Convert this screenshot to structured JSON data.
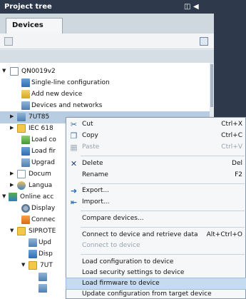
{
  "panel": {
    "title": "Project tree",
    "tab": "Devices"
  },
  "tree": {
    "rows": [
      {
        "label": "QN0019v2"
      },
      {
        "label": "Single-line configuration"
      },
      {
        "label": "Add new device"
      },
      {
        "label": "Devices and networks"
      },
      {
        "label": "7UT85"
      },
      {
        "label": "IEC 618"
      },
      {
        "label": "Load co"
      },
      {
        "label": "Load fir"
      },
      {
        "label": "Upgrad"
      },
      {
        "label": "Docum"
      },
      {
        "label": "Langua"
      },
      {
        "label": "Online acc"
      },
      {
        "label": "Display"
      },
      {
        "label": "Connec"
      },
      {
        "label": "SIPROTE"
      },
      {
        "label": "Upd"
      },
      {
        "label": "Disp"
      },
      {
        "label": "7UT"
      }
    ]
  },
  "context_menu": {
    "items": [
      {
        "label": "Cut",
        "shortcut": "Ctrl+X",
        "icon": "scissors-icon"
      },
      {
        "label": "Copy",
        "shortcut": "Ctrl+C",
        "icon": "copy-icon"
      },
      {
        "label": "Paste",
        "shortcut": "Ctrl+V",
        "icon": "paste-icon"
      },
      {
        "label": "Delete",
        "shortcut": "Del",
        "icon": "delete-icon"
      },
      {
        "label": "Rename",
        "shortcut": "F2"
      },
      {
        "label": "Export...",
        "icon": "export-icon"
      },
      {
        "label": "Import...",
        "icon": "import-icon"
      },
      {
        "label": "Compare devices..."
      },
      {
        "label": "Connect to device and retrieve data",
        "shortcut": "Alt+Ctrl+O"
      },
      {
        "label": "Connect to device"
      },
      {
        "label": "Load configuration to device"
      },
      {
        "label": "Load security settings to device"
      },
      {
        "label": "Load firmware to device"
      },
      {
        "label": "Update configuration from target device"
      }
    ]
  },
  "colors": {
    "title_bar": "#2e3a4b",
    "selection": "#b9cde2",
    "menu_highlight": "#c7dbef",
    "delete_red": "#c0282a"
  }
}
